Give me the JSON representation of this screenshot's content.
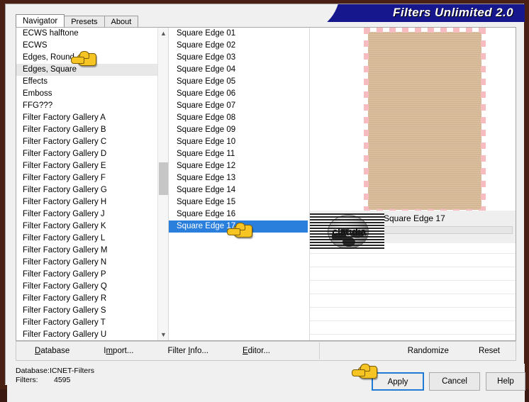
{
  "window": {
    "title": "Filters Unlimited 2.0"
  },
  "tabs": [
    {
      "label": "Navigator",
      "active": true
    },
    {
      "label": "Presets",
      "active": false
    },
    {
      "label": "About",
      "active": false
    }
  ],
  "category_list": {
    "selected": "Edges, Square",
    "items": [
      "ECWS halftone",
      "ECWS",
      "Edges, Round",
      "Edges, Square",
      "Effects",
      "Emboss",
      "FFG???",
      "Filter Factory Gallery A",
      "Filter Factory Gallery B",
      "Filter Factory Gallery C",
      "Filter Factory Gallery D",
      "Filter Factory Gallery E",
      "Filter Factory Gallery F",
      "Filter Factory Gallery G",
      "Filter Factory Gallery H",
      "Filter Factory Gallery J",
      "Filter Factory Gallery K",
      "Filter Factory Gallery L",
      "Filter Factory Gallery M",
      "Filter Factory Gallery N",
      "Filter Factory Gallery P",
      "Filter Factory Gallery Q",
      "Filter Factory Gallery R",
      "Filter Factory Gallery S",
      "Filter Factory Gallery T",
      "Filter Factory Gallery U"
    ]
  },
  "filter_list": {
    "selected": "Square Edge 17",
    "items": [
      "Square Edge 01",
      "Square Edge 02",
      "Square Edge 03",
      "Square Edge 04",
      "Square Edge 05",
      "Square Edge 06",
      "Square Edge 07",
      "Square Edge 08",
      "Square Edge 09",
      "Square Edge 10",
      "Square Edge 11",
      "Square Edge 12",
      "Square Edge 13",
      "Square Edge 14",
      "Square Edge 15",
      "Square Edge 16",
      "Square Edge 17"
    ]
  },
  "preview": {
    "filter_name": "Square Edge 17",
    "image_fill_color": "#d8bb99",
    "edge_color": "#f7bcc0",
    "watermark_text": "claudia"
  },
  "toolbar": {
    "database_label": "Database",
    "database_accel": "D",
    "import_label": "Import...",
    "import_accel": "m",
    "filter_info_label": "Filter Info...",
    "filter_info_accel": "I",
    "editor_label": "Editor...",
    "editor_accel": "E",
    "randomize_label": "Randomize",
    "reset_label": "Reset"
  },
  "status": {
    "database_key": "Database:",
    "database_value": "ICNET-Filters",
    "filters_key": "Filters:",
    "filters_value": "4595"
  },
  "buttons": {
    "apply_label": "Apply",
    "cancel_label": "Cancel",
    "help_label": "Help",
    "apply_focus_color": "#1f7bd6"
  },
  "scrollbar": {
    "up_glyph": "▲",
    "down_glyph": "▼"
  }
}
